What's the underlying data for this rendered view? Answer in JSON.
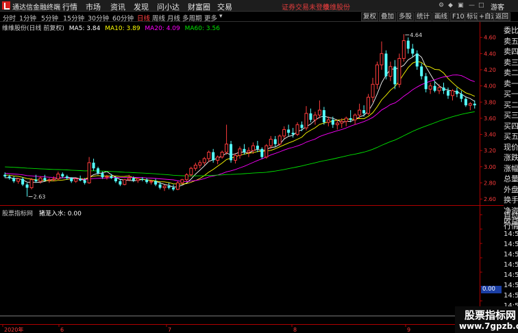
{
  "titlebar": {
    "app_name": "通达信金融终端",
    "menus": [
      "行情",
      "市场",
      "资讯",
      "发现",
      "问小达",
      "财富圈",
      "交易"
    ],
    "notice_left": "证券交易未登录",
    "notice_right": "维维股份",
    "guest": "游客"
  },
  "toolbar": {
    "periods": [
      "分时",
      "1分钟",
      "5分钟",
      "15分钟",
      "30分钟",
      "60分钟",
      "日线",
      "周线",
      "月线",
      "多周期",
      "更多"
    ],
    "active_period": "日线",
    "buttons": [
      "复权",
      "叠加",
      "多股",
      "统计",
      "画线",
      "F10",
      "标记",
      "+自选",
      "返回"
    ]
  },
  "main_legend": {
    "title": "维维股份(日线 前复权)",
    "ma5": "MA5: 3.84",
    "ma10": "MA10: 3.89",
    "ma20": "MA20: 4.09",
    "ma60": "MA60: 3.56"
  },
  "indicator": {
    "name": "股票指标网",
    "series_label": "猪茏入水: 0.00",
    "current_value": "0.00"
  },
  "right_panel": {
    "items": [
      "委比",
      "卖五",
      "卖四",
      "卖三",
      "卖二",
      "卖一",
      "买一",
      "买二",
      "买三",
      "买四",
      "买五",
      "现价",
      "涨跌",
      "涨幅",
      "总量",
      "外盘",
      "换手",
      "净资",
      "收益"
    ],
    "lower_items": [
      "自动",
      "行情",
      "14:50",
      "14:50",
      "14:50",
      "14:50",
      "14:50",
      "14:50",
      "14:50",
      "14:50"
    ]
  },
  "watermark": {
    "line1": "股票指标网",
    "line2": "www.7gpzb.com"
  },
  "colors": {
    "up": "#ff3c3c",
    "down": "#54ffff",
    "ma5": "#ffffff",
    "ma10": "#ffff00",
    "ma20": "#ff00ff",
    "ma60": "#00e600",
    "axis_red": "#b00000"
  },
  "chart_data": {
    "type": "candlestick",
    "y_ticks": [
      "4.60",
      "4.40",
      "4.20",
      "4.00",
      "3.80",
      "3.60",
      "3.40",
      "3.20",
      "3.00",
      "2.80",
      "2.60"
    ],
    "x_labels": [
      "2020年",
      "6",
      "7",
      "8",
      "9"
    ],
    "annotations": {
      "high": "4.64",
      "low": "2.63"
    },
    "ylim": [
      2.55,
      4.75
    ],
    "candles": [
      [
        2.9,
        2.93,
        2.86,
        2.88
      ],
      [
        2.88,
        2.9,
        2.84,
        2.86
      ],
      [
        2.86,
        2.88,
        2.8,
        2.82
      ],
      [
        2.82,
        2.86,
        2.79,
        2.85
      ],
      [
        2.85,
        2.87,
        2.76,
        2.78
      ],
      [
        2.78,
        2.8,
        2.63,
        2.74
      ],
      [
        2.74,
        2.86,
        2.72,
        2.84
      ],
      [
        2.84,
        2.9,
        2.8,
        2.82
      ],
      [
        2.82,
        2.88,
        2.79,
        2.86
      ],
      [
        2.86,
        2.9,
        2.82,
        2.83
      ],
      [
        2.83,
        2.86,
        2.8,
        2.84
      ],
      [
        2.84,
        2.88,
        2.82,
        2.85
      ],
      [
        2.85,
        2.94,
        2.83,
        2.91
      ],
      [
        2.91,
        2.93,
        2.86,
        2.88
      ],
      [
        2.88,
        2.9,
        2.84,
        2.86
      ],
      [
        2.86,
        2.87,
        2.8,
        2.82
      ],
      [
        2.82,
        2.86,
        2.8,
        2.85
      ],
      [
        2.85,
        2.89,
        2.82,
        2.83
      ],
      [
        2.83,
        2.86,
        2.78,
        2.8
      ],
      [
        2.8,
        3.12,
        2.79,
        3.05
      ],
      [
        3.05,
        3.1,
        2.95,
        2.98
      ],
      [
        2.98,
        3.0,
        2.9,
        2.92
      ],
      [
        2.92,
        2.94,
        2.85,
        2.87
      ],
      [
        2.87,
        2.9,
        2.84,
        2.88
      ],
      [
        2.88,
        2.91,
        2.85,
        2.86
      ],
      [
        2.86,
        2.88,
        2.8,
        2.82
      ],
      [
        2.82,
        2.84,
        2.76,
        2.78
      ],
      [
        2.78,
        2.85,
        2.77,
        2.84
      ],
      [
        2.84,
        2.9,
        2.82,
        2.86
      ],
      [
        2.86,
        2.88,
        2.81,
        2.83
      ],
      [
        2.83,
        2.86,
        2.8,
        2.85
      ],
      [
        2.85,
        2.87,
        2.82,
        2.84
      ],
      [
        2.84,
        2.86,
        2.79,
        2.81
      ],
      [
        2.81,
        2.84,
        2.78,
        2.82
      ],
      [
        2.82,
        2.85,
        2.76,
        2.78
      ],
      [
        2.78,
        2.81,
        2.72,
        2.74
      ],
      [
        2.74,
        2.78,
        2.7,
        2.76
      ],
      [
        2.76,
        2.8,
        2.72,
        2.74
      ],
      [
        2.74,
        2.78,
        2.7,
        2.72
      ],
      [
        2.72,
        2.82,
        2.71,
        2.8
      ],
      [
        2.8,
        2.85,
        2.78,
        2.84
      ],
      [
        2.84,
        2.92,
        2.82,
        2.9
      ],
      [
        2.9,
        3.0,
        2.88,
        2.98
      ],
      [
        2.98,
        3.05,
        2.95,
        3.02
      ],
      [
        3.02,
        3.08,
        2.98,
        3.05
      ],
      [
        3.05,
        3.12,
        3.02,
        3.1
      ],
      [
        3.1,
        3.2,
        3.06,
        3.18
      ],
      [
        3.18,
        3.22,
        3.05,
        3.08
      ],
      [
        3.08,
        3.14,
        3.03,
        3.12
      ],
      [
        3.12,
        3.2,
        3.1,
        3.18
      ],
      [
        3.18,
        3.52,
        3.15,
        3.28
      ],
      [
        3.28,
        3.32,
        3.05,
        3.08
      ],
      [
        3.08,
        3.16,
        3.04,
        3.14
      ],
      [
        3.14,
        3.25,
        3.1,
        3.22
      ],
      [
        3.22,
        3.28,
        3.15,
        3.18
      ],
      [
        3.18,
        3.24,
        3.12,
        3.2
      ],
      [
        3.2,
        3.3,
        3.16,
        3.26
      ],
      [
        3.26,
        3.32,
        3.18,
        3.22
      ],
      [
        3.22,
        3.24,
        3.1,
        3.12
      ],
      [
        3.12,
        3.28,
        3.1,
        3.26
      ],
      [
        3.26,
        3.38,
        3.22,
        3.34
      ],
      [
        3.34,
        3.38,
        3.25,
        3.28
      ],
      [
        3.28,
        3.4,
        3.26,
        3.38
      ],
      [
        3.38,
        3.5,
        3.35,
        3.46
      ],
      [
        3.46,
        3.52,
        3.38,
        3.42
      ],
      [
        3.42,
        3.48,
        3.36,
        3.4
      ],
      [
        3.4,
        3.55,
        3.38,
        3.52
      ],
      [
        3.52,
        3.56,
        3.44,
        3.48
      ],
      [
        3.48,
        3.75,
        3.45,
        3.66
      ],
      [
        3.66,
        3.72,
        3.55,
        3.58
      ],
      [
        3.58,
        3.68,
        3.52,
        3.64
      ],
      [
        3.64,
        3.82,
        3.6,
        3.7
      ],
      [
        3.7,
        3.74,
        3.52,
        3.55
      ],
      [
        3.55,
        3.62,
        3.5,
        3.58
      ],
      [
        3.58,
        3.62,
        3.48,
        3.52
      ],
      [
        3.52,
        3.58,
        3.46,
        3.54
      ],
      [
        3.54,
        3.6,
        3.48,
        3.56
      ],
      [
        3.56,
        3.62,
        3.5,
        3.6
      ],
      [
        3.6,
        3.7,
        3.55,
        3.58
      ],
      [
        3.58,
        3.66,
        3.52,
        3.64
      ],
      [
        3.64,
        3.78,
        3.6,
        3.7
      ],
      [
        3.7,
        3.76,
        3.62,
        3.66
      ],
      [
        3.66,
        3.9,
        3.64,
        3.86
      ],
      [
        3.86,
        4.1,
        3.8,
        4.02
      ],
      [
        4.02,
        4.3,
        3.96,
        4.26
      ],
      [
        4.26,
        4.55,
        4.2,
        4.4
      ],
      [
        4.4,
        4.44,
        4.08,
        4.12
      ],
      [
        4.12,
        4.3,
        4.06,
        4.24
      ],
      [
        4.24,
        4.32,
        3.96,
        4.02
      ],
      [
        4.02,
        4.4,
        3.98,
        4.34
      ],
      [
        4.34,
        4.64,
        4.3,
        4.56
      ],
      [
        4.56,
        4.6,
        4.4,
        4.46
      ],
      [
        4.46,
        4.52,
        4.36,
        4.4
      ],
      [
        4.4,
        4.44,
        4.2,
        4.24
      ],
      [
        4.24,
        4.28,
        4.08,
        4.12
      ],
      [
        4.12,
        4.16,
        3.92,
        3.96
      ],
      [
        3.96,
        4.04,
        3.9,
        4.0
      ],
      [
        4.0,
        4.06,
        3.92,
        3.94
      ],
      [
        3.94,
        4.02,
        3.9,
        3.98
      ],
      [
        3.98,
        4.04,
        3.9,
        3.94
      ],
      [
        3.94,
        3.98,
        3.84,
        3.88
      ],
      [
        3.88,
        3.96,
        3.82,
        3.94
      ],
      [
        3.94,
        3.98,
        3.86,
        3.9
      ],
      [
        3.9,
        3.94,
        3.8,
        3.84
      ],
      [
        3.84,
        3.86,
        3.74,
        3.76
      ],
      [
        3.76,
        3.8,
        3.7,
        3.78
      ],
      [
        3.78,
        3.82,
        3.72,
        3.76
      ]
    ]
  }
}
